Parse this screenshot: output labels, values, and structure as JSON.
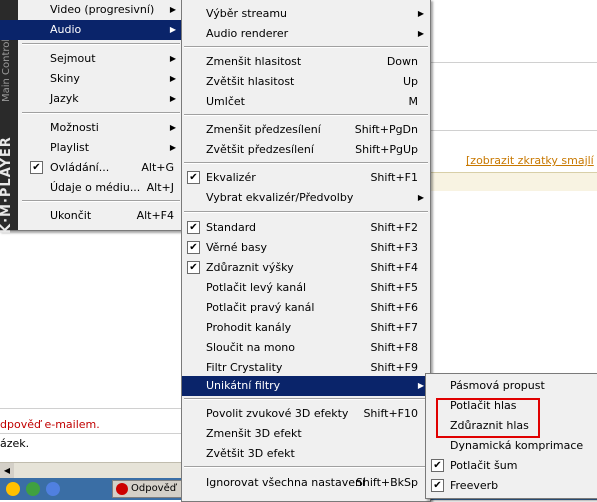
{
  "background": {
    "link": "[zobrazit zkratky smajlí",
    "reply_text": "dpověď e-mailem.",
    "image_text": "ázek.",
    "taskbar_button": "Odpověď"
  },
  "sidebar_brand": "K·M·PLAYER",
  "sidebar_subtitle": "Main Control",
  "main_menu": [
    {
      "label": "Video (progresivní)",
      "arrow": true
    },
    {
      "label": "Audio",
      "arrow": true,
      "highlight": true
    },
    {
      "label": "Sejmout",
      "arrow": true
    },
    {
      "label": "Skiny",
      "arrow": true
    },
    {
      "label": "Jazyk",
      "arrow": true
    },
    {
      "label": "Možnosti",
      "arrow": true
    },
    {
      "label": "Playlist",
      "arrow": true
    },
    {
      "label": "Ovládání...",
      "shortcut": "Alt+G",
      "checked": true
    },
    {
      "label": "Údaje o médiu...",
      "shortcut": "Alt+J"
    },
    {
      "label": "Ukončit",
      "shortcut": "Alt+F4"
    }
  ],
  "audio_menu": [
    {
      "label": "Výběr streamu",
      "arrow": true
    },
    {
      "label": "Audio renderer",
      "arrow": true
    },
    {
      "label": "Zmenšit hlasitost",
      "shortcut": "Down"
    },
    {
      "label": "Zvětšit hlasitost",
      "shortcut": "Up"
    },
    {
      "label": "Umlčet",
      "shortcut": "M"
    },
    {
      "label": "Zmenšit předzesílení",
      "shortcut": "Shift+PgDn"
    },
    {
      "label": "Zvětšit předzesílení",
      "shortcut": "Shift+PgUp"
    },
    {
      "label": "Ekvalizér",
      "shortcut": "Shift+F1",
      "checked": true
    },
    {
      "label": "Vybrat ekvalizér/Předvolby",
      "arrow": true
    },
    {
      "label": "Standard",
      "shortcut": "Shift+F2",
      "checked": true
    },
    {
      "label": "Věrné basy",
      "shortcut": "Shift+F3",
      "checked": true
    },
    {
      "label": "Zdůraznit výšky",
      "shortcut": "Shift+F4",
      "checked": true
    },
    {
      "label": "Potlačit levý kanál",
      "shortcut": "Shift+F5"
    },
    {
      "label": "Potlačit pravý kanál",
      "shortcut": "Shift+F6"
    },
    {
      "label": "Prohodit kanály",
      "shortcut": "Shift+F7"
    },
    {
      "label": "Sloučit na mono",
      "shortcut": "Shift+F8"
    },
    {
      "label": "Filtr Crystality",
      "shortcut": "Shift+F9"
    },
    {
      "label": "Unikátní filtry",
      "arrow": true,
      "highlight": true
    },
    {
      "label": "Povolit zvukové 3D efekty",
      "shortcut": "Shift+F10"
    },
    {
      "label": "Zmenšit 3D efekt"
    },
    {
      "label": "Zvětšit 3D efekt"
    },
    {
      "label": "Ignorovat všechna nastavení",
      "shortcut": "Shift+BkSp"
    }
  ],
  "filters_menu": [
    {
      "label": "Pásmová propust"
    },
    {
      "label": "Potlačit hlas"
    },
    {
      "label": "Zdůraznit hlas"
    },
    {
      "label": "Dynamická komprimace"
    },
    {
      "label": "Potlačit šum",
      "checked": true
    },
    {
      "label": "Freeverb",
      "checked": true
    }
  ],
  "colors": {
    "highlight": "#0a246a",
    "annotation": "#e00000",
    "link": "#c87800"
  }
}
